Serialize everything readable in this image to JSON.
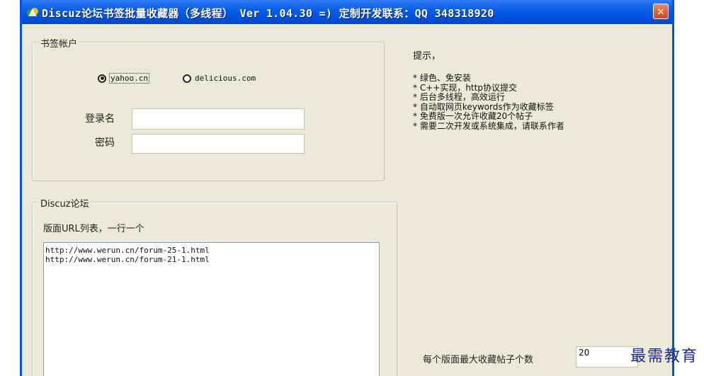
{
  "window": {
    "title": "Discuz论坛书签批量收藏器（多线程） Ver 1.04.30  =) 定制开发联系：QQ 348318920",
    "close_glyph": "✕"
  },
  "account_group": {
    "legend": "书签帐户",
    "radio_options": [
      {
        "label": "yahoo.cn",
        "selected": true
      },
      {
        "label": "delicious.com",
        "selected": false
      }
    ],
    "username_label": "登录名",
    "username_value": "",
    "password_label": "密码",
    "password_value": ""
  },
  "forum_group": {
    "legend": "Discuz论坛",
    "url_list_label": "版面URL列表，一行一个",
    "urls": [
      "http://www.werun.cn/forum-25-1.html",
      "http://www.werun.cn/forum-21-1.html"
    ]
  },
  "tips": {
    "heading": "提示，",
    "items": [
      "绿色、免安装",
      "C++实现，http协议提交",
      "后台多线程，高效运行",
      "自动取网页keywords作为收藏标签",
      "免费版一次允许收藏20个帖子",
      "需要二次开发或系统集成，请联系作者"
    ]
  },
  "max_posts": {
    "label": "每个版面最大收藏帖子个数",
    "value": "20"
  },
  "watermark": "最需教育",
  "colors": {
    "titlebar": "#0054e3",
    "window_bg": "#ece9d8",
    "close_button": "#d2461f"
  }
}
